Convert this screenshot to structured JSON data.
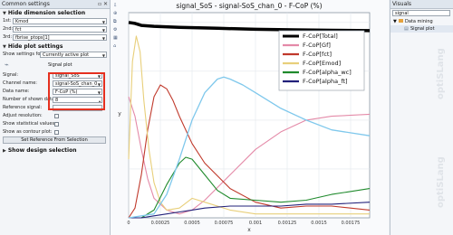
{
  "left_panel": {
    "title": "Common settings",
    "hide_dimension": "Hide dimension selection",
    "dims": [
      {
        "label": "1st:",
        "value": "Kmod"
      },
      {
        "label": "2nd:",
        "value": "fct"
      },
      {
        "label": "3rd:",
        "value": "fbrise_ptops[1]"
      }
    ],
    "hide_plot_settings": "Hide plot settings",
    "show_settings_label": "Show settings for:",
    "show_settings_value": "Currently active plot",
    "signal_plot_heading": "Signal plot",
    "signal_label": "Signal:",
    "signal_value": "signal_SoS",
    "channel_label": "Channel name:",
    "channel_value": "signal-SoS_chan_0",
    "data_label": "Data name:",
    "data_value": "F-CoP (%)",
    "shown_data_label": "Number of shown datas:",
    "shown_data_value": "8",
    "reference_label": "Reference signal:",
    "adjust_label": "Adjust resolution:",
    "show_stat_label": "Show statistical values:",
    "contour_label": "Show as contour plot:",
    "set_ref_button": "Set Reference From Selection",
    "show_design": "Show design selection"
  },
  "chart_header": {
    "title": "signal_SoS - signal-SoS_chan_0 - F-CoP (%)"
  },
  "chart_data": {
    "type": "line",
    "title": "signal_SoS - signal-SoS_chan_0 - F-CoP (%)",
    "xlabel": "x",
    "ylabel": "y",
    "xlim": [
      0,
      0.0019
    ],
    "ylim": [
      0,
      1.05
    ],
    "x_ticks": [
      "0",
      "0.00025",
      "0.0005",
      "0.00075",
      "0.001",
      "0.00125",
      "0.0015",
      "0.00175"
    ],
    "legend_position": "top-right",
    "series": [
      {
        "name": "F-CoP[Total]",
        "color": "#000000",
        "width": 3.5,
        "x": [
          0,
          5e-05,
          0.0001,
          0.0002,
          0.0004,
          0.0007,
          0.001,
          0.0013,
          0.0016,
          0.0019
        ],
        "y": [
          1.0,
          0.995,
          0.985,
          0.98,
          0.975,
          0.97,
          0.965,
          0.962,
          0.96,
          0.958
        ]
      },
      {
        "name": "F-CoP[Gf]",
        "color": "#e48aa8",
        "width": 1.1,
        "x": [
          0,
          5e-05,
          0.0001,
          0.00015,
          0.0002,
          0.0003,
          0.0004,
          0.0005,
          0.0006,
          0.0008,
          0.001,
          0.0012,
          0.0014,
          0.0016,
          0.0019
        ],
        "y": [
          0.62,
          0.52,
          0.35,
          0.2,
          0.1,
          0.04,
          0.02,
          0.04,
          0.09,
          0.22,
          0.35,
          0.44,
          0.5,
          0.52,
          0.53
        ]
      },
      {
        "name": "F-CoP[fct]",
        "color": "#c0392b",
        "width": 1.1,
        "x": [
          0,
          5e-05,
          0.0001,
          0.00015,
          0.0002,
          0.00025,
          0.0003,
          0.00035,
          0.0004,
          0.0005,
          0.0006,
          0.0008,
          0.001,
          0.0012,
          0.0014,
          0.0016,
          0.0019
        ],
        "y": [
          0.0,
          0.05,
          0.22,
          0.45,
          0.62,
          0.68,
          0.66,
          0.6,
          0.52,
          0.38,
          0.28,
          0.15,
          0.08,
          0.05,
          0.06,
          0.06,
          0.04
        ]
      },
      {
        "name": "F-CoP[Emod]",
        "color": "#e8cf7a",
        "width": 1.1,
        "x": [
          0,
          3e-05,
          6e-05,
          9e-05,
          0.00012,
          0.00016,
          0.0002,
          0.00025,
          0.0003,
          0.0004,
          0.0005,
          0.0006,
          0.0008,
          0.001,
          0.0014,
          0.0019
        ],
        "y": [
          0.3,
          0.8,
          0.93,
          0.85,
          0.6,
          0.35,
          0.18,
          0.08,
          0.04,
          0.05,
          0.1,
          0.08,
          0.04,
          0.02,
          0.02,
          0.02
        ]
      },
      {
        "name": "F-CoP[alpha_wc]",
        "color": "#1f8a2c",
        "width": 1.1,
        "x": [
          0,
          0.0001,
          0.0002,
          0.0003,
          0.0004,
          0.00045,
          0.0005,
          0.0006,
          0.0007,
          0.0008,
          0.001,
          0.0012,
          0.0014,
          0.0016,
          0.0019
        ],
        "y": [
          0.0,
          0.0,
          0.04,
          0.17,
          0.28,
          0.31,
          0.3,
          0.22,
          0.14,
          0.1,
          0.09,
          0.08,
          0.09,
          0.12,
          0.15
        ]
      },
      {
        "name": "F-CoP[alpha_ft]",
        "color": "#22207a",
        "width": 1.1,
        "x": [
          0,
          0.0001,
          0.0002,
          0.0003,
          0.0004,
          0.0005,
          0.0006,
          0.0008,
          0.001,
          0.0012,
          0.0014,
          0.0016,
          0.0019
        ],
        "y": [
          0.0,
          0.0,
          0.01,
          0.02,
          0.03,
          0.04,
          0.05,
          0.06,
          0.06,
          0.06,
          0.07,
          0.07,
          0.08
        ]
      },
      {
        "name": "",
        "color": "#7fc8ec",
        "width": 1.3,
        "x": [
          0,
          0.0002,
          0.0003,
          0.0004,
          0.0005,
          0.0006,
          0.0007,
          0.00075,
          0.0008,
          0.0009,
          0.001,
          0.0012,
          0.0014,
          0.0016,
          0.0019
        ],
        "y": [
          0.0,
          0.02,
          0.12,
          0.3,
          0.5,
          0.64,
          0.71,
          0.72,
          0.71,
          0.68,
          0.64,
          0.56,
          0.5,
          0.45,
          0.42
        ]
      }
    ]
  },
  "right_panel": {
    "title": "Visuals",
    "search_value": "signal",
    "tree_root": "Data mining",
    "tree_child": "Signal plot"
  },
  "watermark": "optiSLang",
  "colors": {
    "accent_red": "#e5301f"
  }
}
